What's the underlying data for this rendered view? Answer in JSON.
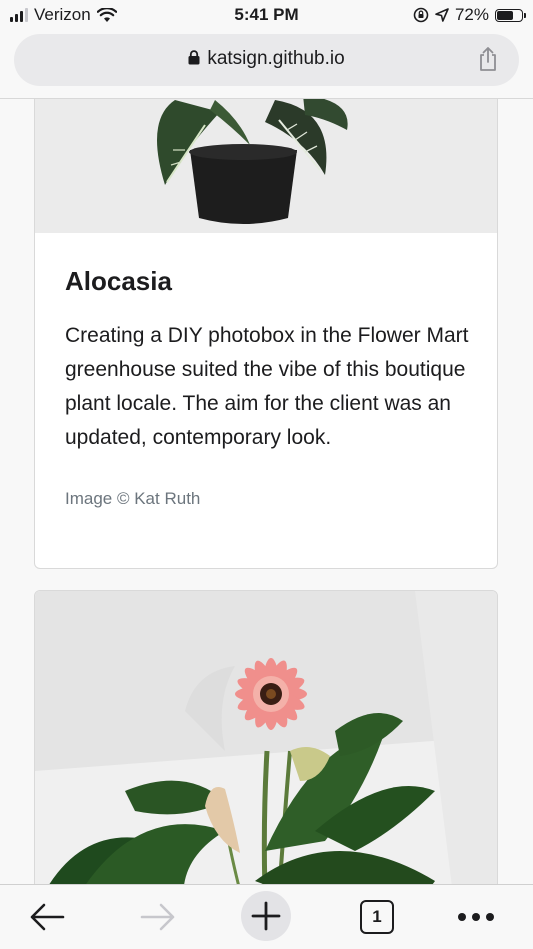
{
  "status": {
    "carrier": "Verizon",
    "time": "5:41 PM",
    "battery": "72%",
    "battery_level": 0.72
  },
  "browser": {
    "url": "katsign.github.io",
    "tab_count": "1"
  },
  "cards": [
    {
      "title": "Alocasia",
      "text": "Creating a DIY photobox in the Flower Mart greenhouse suited the vibe of this boutique plant locale. The aim for the client was an updated, contemporary look.",
      "credit": "Image © Kat Ruth"
    }
  ],
  "colors": {
    "accent": "#1c1c1e",
    "muted": "#6c757d",
    "disabled": "#c7c7cc"
  },
  "icons": [
    "signal-icon",
    "wifi-icon",
    "orientation-lock-icon",
    "location-icon",
    "battery-icon",
    "lock-icon",
    "share-icon",
    "back-arrow-icon",
    "forward-arrow-icon",
    "plus-icon",
    "more-icon"
  ]
}
